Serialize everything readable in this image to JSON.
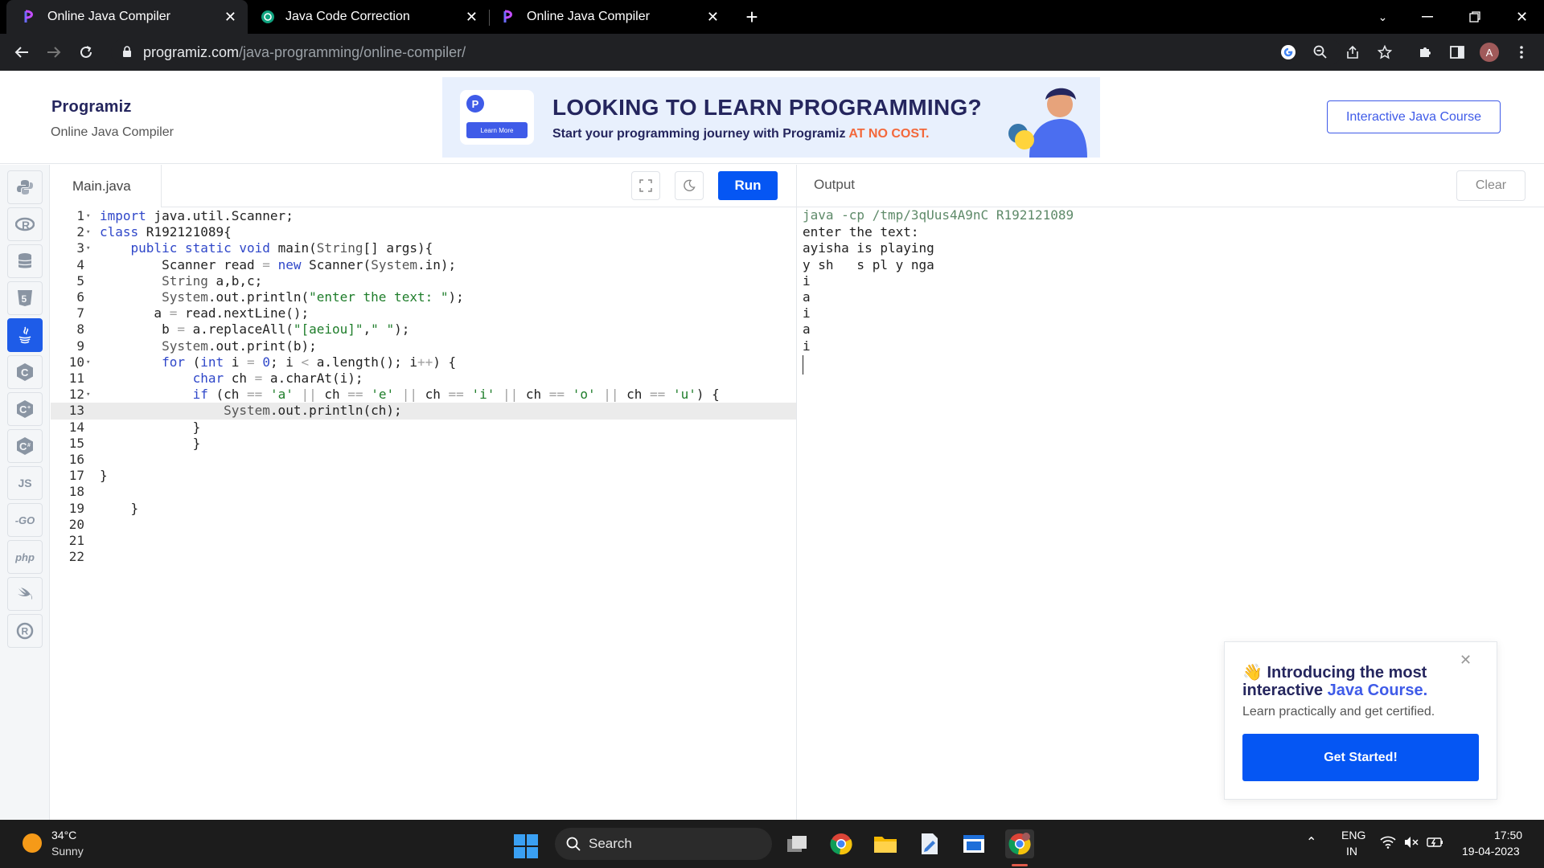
{
  "browser": {
    "tabs": [
      {
        "title": "Online Java Compiler",
        "active": true
      },
      {
        "title": "Java Code Correction",
        "active": false
      },
      {
        "title": "Online Java Compiler",
        "active": false
      }
    ],
    "new_tab": "+",
    "url_host": "programiz.com",
    "url_path": "/java-programming/online-compiler/",
    "profile_initial": "A"
  },
  "site": {
    "logo": "Programiz",
    "subtitle": "Online Java Compiler",
    "banner_headline": "LOOKING TO LEARN PROGRAMMING?",
    "banner_sub": "Start your programming journey with Programiz ",
    "banner_sub_highlight": "AT NO COST.",
    "banner_learn_more": "Learn More",
    "course_button": "Interactive Java Course"
  },
  "rail": {
    "languages": [
      {
        "name": "python-icon",
        "glyph": "🐍"
      },
      {
        "name": "r-icon",
        "glyph": "R"
      },
      {
        "name": "sql-icon",
        "glyph": "≣"
      },
      {
        "name": "html-icon",
        "glyph": "5"
      },
      {
        "name": "java-icon",
        "glyph": "☕",
        "active": true
      },
      {
        "name": "c-icon",
        "glyph": "C"
      },
      {
        "name": "cpp-icon",
        "glyph": "C"
      },
      {
        "name": "csharp-icon",
        "glyph": "C"
      },
      {
        "name": "js-icon",
        "glyph": "JS"
      },
      {
        "name": "go-icon",
        "glyph": "GO"
      },
      {
        "name": "php-icon",
        "glyph": "php"
      },
      {
        "name": "swift-icon",
        "glyph": "➶"
      },
      {
        "name": "rust-icon",
        "glyph": "®"
      }
    ]
  },
  "editor": {
    "file_name": "Main.java",
    "run_label": "Run",
    "highlighted_line": 13,
    "lines": [
      {
        "n": "1",
        "fold": true,
        "code": "import java.util.Scanner;"
      },
      {
        "n": "2",
        "fold": true,
        "code": "class R192121089{"
      },
      {
        "n": "3",
        "fold": true,
        "code": "    public static void main(String[] args){"
      },
      {
        "n": "4",
        "fold": false,
        "code": "        Scanner read = new Scanner(System.in);"
      },
      {
        "n": "5",
        "fold": false,
        "code": "        String a,b,c;"
      },
      {
        "n": "6",
        "fold": false,
        "code": "        System.out.println(\"enter the text: \");"
      },
      {
        "n": "7",
        "fold": false,
        "code": "       a = read.nextLine();"
      },
      {
        "n": "8",
        "fold": false,
        "code": "        b = a.replaceAll(\"[aeiou]\",\" \");"
      },
      {
        "n": "9",
        "fold": false,
        "code": "        System.out.print(b);"
      },
      {
        "n": "10",
        "fold": true,
        "code": "        for (int i = 0; i < a.length(); i++) {"
      },
      {
        "n": "11",
        "fold": false,
        "code": "            char ch = a.charAt(i);"
      },
      {
        "n": "12",
        "fold": true,
        "code": "            if (ch == 'a' || ch == 'e' || ch == 'i' || ch == 'o' || ch == 'u') {"
      },
      {
        "n": "13",
        "fold": false,
        "code": "                System.out.println(ch);"
      },
      {
        "n": "14",
        "fold": false,
        "code": "            }"
      },
      {
        "n": "15",
        "fold": false,
        "code": "            }"
      },
      {
        "n": "16",
        "fold": false,
        "code": ""
      },
      {
        "n": "17",
        "fold": false,
        "code": "}"
      },
      {
        "n": "18",
        "fold": false,
        "code": ""
      },
      {
        "n": "19",
        "fold": false,
        "code": "    }"
      },
      {
        "n": "20",
        "fold": false,
        "code": ""
      },
      {
        "n": "21",
        "fold": false,
        "code": ""
      },
      {
        "n": "22",
        "fold": false,
        "code": ""
      }
    ]
  },
  "output": {
    "title": "Output",
    "clear_label": "Clear",
    "command": "java -cp /tmp/3qUus4A9nC R192121089",
    "lines": [
      "enter the text:",
      "ayisha is playing",
      "y sh   s pl y nga",
      "i",
      "a",
      "i",
      "a",
      "i"
    ]
  },
  "promo": {
    "emoji": "👋",
    "title_part1": "Introducing the most interactive ",
    "title_highlight": "Java Course.",
    "subtitle": "Learn practically and get certified.",
    "button": "Get Started!"
  },
  "taskbar": {
    "temperature": "34°C",
    "condition": "Sunny",
    "search_label": "Search",
    "language": "ENG",
    "region": "IN",
    "time": "17:50",
    "date": "19-04-2023"
  },
  "colors": {
    "accent": "#0556f3",
    "brand_dark": "#25265e",
    "keyword": "#2f47c9",
    "string": "#1e7d2a",
    "banner_highlight": "#f3683b"
  }
}
